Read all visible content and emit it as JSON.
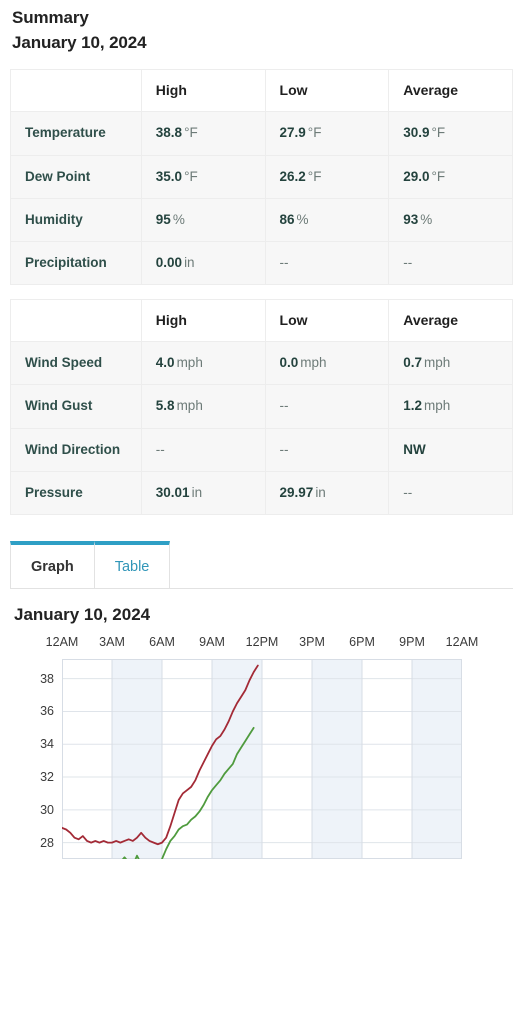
{
  "header": {
    "title": "Summary",
    "date": "January 10, 2024"
  },
  "table_one": {
    "columns": [
      "",
      "High",
      "Low",
      "Average"
    ],
    "rows": [
      {
        "label": "Temperature",
        "high": {
          "num": "38.8",
          "unit": "°F"
        },
        "low": {
          "num": "27.9",
          "unit": "°F"
        },
        "average": {
          "num": "30.9",
          "unit": "°F"
        }
      },
      {
        "label": "Dew Point",
        "high": {
          "num": "35.0",
          "unit": "°F"
        },
        "low": {
          "num": "26.2",
          "unit": "°F"
        },
        "average": {
          "num": "29.0",
          "unit": "°F"
        }
      },
      {
        "label": "Humidity",
        "high": {
          "num": "95",
          "unit": "%"
        },
        "low": {
          "num": "86",
          "unit": "%"
        },
        "average": {
          "num": "93",
          "unit": "%"
        }
      },
      {
        "label": "Precipitation",
        "high": {
          "num": "0.00",
          "unit": "in"
        },
        "low": {
          "num": "--",
          "unit": ""
        },
        "average": {
          "num": "--",
          "unit": ""
        }
      }
    ]
  },
  "table_two": {
    "columns": [
      "",
      "High",
      "Low",
      "Average"
    ],
    "rows": [
      {
        "label": "Wind Speed",
        "high": {
          "num": "4.0",
          "unit": "mph"
        },
        "low": {
          "num": "0.0",
          "unit": "mph"
        },
        "average": {
          "num": "0.7",
          "unit": "mph"
        }
      },
      {
        "label": "Wind Gust",
        "high": {
          "num": "5.8",
          "unit": "mph"
        },
        "low": {
          "num": "--",
          "unit": ""
        },
        "average": {
          "num": "1.2",
          "unit": "mph"
        }
      },
      {
        "label": "Wind Direction",
        "high": {
          "num": "--",
          "unit": ""
        },
        "low": {
          "num": "--",
          "unit": ""
        },
        "average": {
          "num": "NW",
          "unit": ""
        }
      },
      {
        "label": "Pressure",
        "high": {
          "num": "30.01",
          "unit": "in"
        },
        "low": {
          "num": "29.97",
          "unit": "in"
        },
        "average": {
          "num": "--",
          "unit": ""
        }
      }
    ]
  },
  "tabs": {
    "items": [
      {
        "label": "Graph",
        "active": true
      },
      {
        "label": "Table",
        "active": false
      }
    ],
    "accent_color": "#2e9fc5"
  },
  "chart_data": {
    "type": "line",
    "title": "January 10, 2024",
    "xlabel": "",
    "ylabel": "",
    "grid": true,
    "legend": "none",
    "xticklabels": [
      "12AM",
      "3AM",
      "6AM",
      "9AM",
      "12PM",
      "3PM",
      "6PM",
      "9PM",
      "12AM"
    ],
    "yticklabels": [
      "38",
      "36",
      "34",
      "32",
      "30",
      "28"
    ],
    "ylim": [
      27,
      39.2
    ],
    "xlim_hours": [
      0,
      24
    ],
    "series": [
      {
        "name": "Temperature",
        "color": "#a32a36",
        "x": [
          0,
          0.25,
          0.5,
          0.75,
          1,
          1.25,
          1.5,
          1.75,
          2,
          2.25,
          2.5,
          2.75,
          3,
          3.25,
          3.5,
          3.75,
          4,
          4.25,
          4.5,
          4.75,
          5,
          5.25,
          5.5,
          5.75,
          6,
          6.25,
          6.5,
          6.75,
          7,
          7.25,
          7.5,
          7.75,
          8,
          8.25,
          8.5,
          8.75,
          9,
          9.25,
          9.5,
          9.75,
          10,
          10.25,
          10.5,
          10.75,
          11,
          11.25,
          11.5,
          11.75
        ],
        "values": [
          28.9,
          28.8,
          28.6,
          28.3,
          28.2,
          28.4,
          28.1,
          28.0,
          28.1,
          28.0,
          28.1,
          28.0,
          28.0,
          28.1,
          28.0,
          28.1,
          28.2,
          28.1,
          28.3,
          28.6,
          28.3,
          28.1,
          28.0,
          27.9,
          28.0,
          28.3,
          29.0,
          29.8,
          30.6,
          31.0,
          31.2,
          31.4,
          31.8,
          32.4,
          32.9,
          33.4,
          33.9,
          34.3,
          34.5,
          34.9,
          35.4,
          36.0,
          36.5,
          36.9,
          37.3,
          37.9,
          38.4,
          38.8
        ]
      },
      {
        "name": "Dew Point",
        "color": "#4f9b3e",
        "x": [
          0,
          0.25,
          0.5,
          0.75,
          1,
          1.25,
          1.5,
          1.75,
          2,
          2.25,
          2.5,
          2.75,
          3,
          3.25,
          3.5,
          3.75,
          4,
          4.25,
          4.5,
          4.75,
          5,
          5.25,
          5.5,
          5.75,
          6,
          6.25,
          6.5,
          6.75,
          7,
          7.25,
          7.5,
          7.75,
          8,
          8.25,
          8.5,
          8.75,
          9,
          9.25,
          9.5,
          9.75,
          10,
          10.25,
          10.5,
          10.75,
          11,
          11.25,
          11.5
        ],
        "values": [
          26.9,
          26.7,
          26.4,
          26.6,
          26.3,
          26.5,
          26.3,
          26.3,
          26.4,
          26.3,
          26.3,
          26.3,
          26.4,
          26.5,
          26.8,
          27.1,
          26.8,
          26.6,
          27.2,
          26.7,
          26.5,
          26.4,
          26.3,
          26.5,
          27.0,
          27.6,
          28.1,
          28.4,
          28.8,
          29.0,
          29.1,
          29.4,
          29.6,
          29.9,
          30.3,
          30.8,
          31.2,
          31.5,
          31.8,
          32.2,
          32.5,
          32.8,
          33.4,
          33.8,
          34.2,
          34.6,
          35.0
        ]
      }
    ]
  }
}
